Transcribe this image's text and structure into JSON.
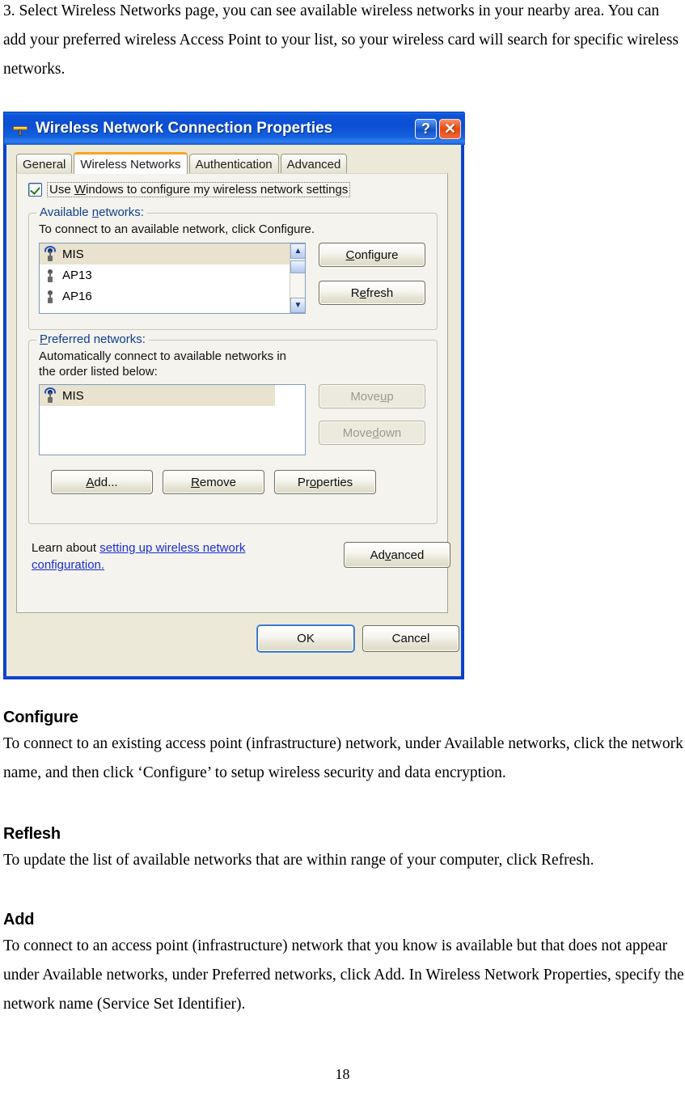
{
  "document": {
    "intro": "3. Select Wireless Networks page, you can see available wireless networks in your nearby area. You can add your preferred wireless Access Point to your list, so your wireless card will search for specific wireless networks.",
    "sections": [
      {
        "heading": "Configure",
        "body": "To connect to an existing access point (infrastructure) network, under Available networks, click the network name, and then click ‘Configure’ to setup wireless security and data encryption."
      },
      {
        "heading": "Reflesh",
        "body": "To update the list of available networks that are within range of your computer, click Refresh."
      },
      {
        "heading": "Add",
        "body": "To connect to an access point (infrastructure) network that you know is available but that does not appear under Available networks, under Preferred networks, click Add. In Wireless Network Properties, specify the network name (Service Set Identifier)."
      }
    ],
    "page_number": "18"
  },
  "dialog": {
    "title": "Wireless Network Connection Properties",
    "title_icon": "network-adapter-icon",
    "help_button": "?",
    "close_button": "✕",
    "tabs": [
      {
        "label": "General",
        "active": false
      },
      {
        "label": "Wireless Networks",
        "active": true
      },
      {
        "label": "Authentication",
        "active": false
      },
      {
        "label": "Advanced",
        "active": false
      }
    ],
    "use_windows_checkbox": {
      "label_pre": "Use ",
      "label_accel": "W",
      "label_post": "indows to configure my wireless network settings",
      "checked": true
    },
    "available_networks": {
      "legend_pre": "Available ",
      "legend_accel": "n",
      "legend_post": "etworks:",
      "description": "To connect to an available network, click Configure.",
      "items": [
        {
          "name": "MIS",
          "selected": true,
          "icon": "wireless-signal-icon-active"
        },
        {
          "name": "AP13",
          "selected": false,
          "icon": "wireless-signal-icon"
        },
        {
          "name": "AP16",
          "selected": false,
          "icon": "wireless-signal-icon"
        }
      ],
      "configure_pre": "",
      "configure_accel": "C",
      "configure_post": "onfigure",
      "refresh_pre": "R",
      "refresh_accel": "e",
      "refresh_post": "fresh"
    },
    "preferred_networks": {
      "legend_accel": "P",
      "legend_post": "referred networks:",
      "description": "Automatically connect to available networks in the order listed below:",
      "items": [
        {
          "name": "MIS",
          "selected": true,
          "icon": "wireless-signal-icon-active"
        }
      ],
      "move_up_pre": "Move ",
      "move_up_accel": "u",
      "move_up_post": "p",
      "move_up_disabled": true,
      "move_down_pre": "Move ",
      "move_down_accel": "d",
      "move_down_post": "own",
      "move_down_disabled": true,
      "add_pre": "",
      "add_accel": "A",
      "add_post": "dd...",
      "remove_pre": "",
      "remove_accel": "R",
      "remove_post": "emove",
      "properties_pre": "Pr",
      "properties_accel": "o",
      "properties_post": "perties"
    },
    "learn_prefix": "Learn about ",
    "learn_link": "setting up wireless network configuration.",
    "advanced_pre": "Ad",
    "advanced_accel": "v",
    "advanced_post": "anced",
    "ok_label": "OK",
    "cancel_label": "Cancel"
  },
  "colors": {
    "titlebar_blue": "#0b4ed4",
    "dialog_face": "#ece9d8",
    "client_face": "#f4f3ee",
    "selection": "#e8e2cf",
    "legend_text": "#0f3f8f",
    "link": "#1a2fd0",
    "active_tab_accent": "#f5a623",
    "close_button": "#e3490e"
  }
}
